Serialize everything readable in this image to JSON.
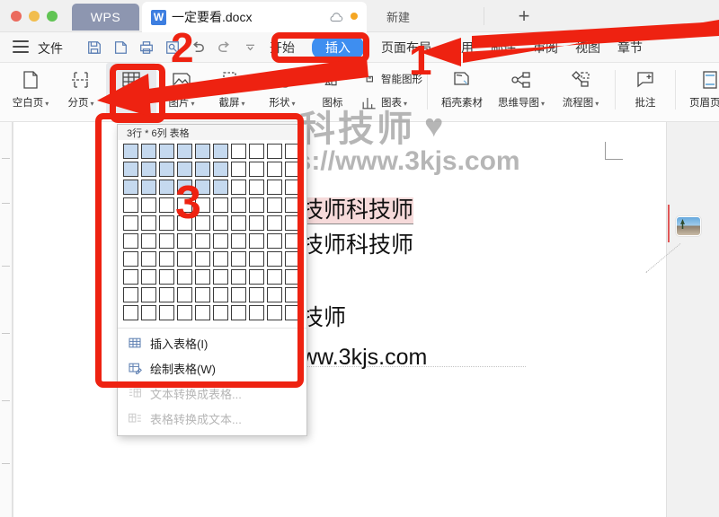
{
  "window": {
    "app_button": "WPS",
    "document_name": "一定要看.docx",
    "new_label": "新建",
    "traffic_lights": [
      "close-red",
      "minimize-yellow",
      "maximize-green"
    ],
    "plus_tab": "+",
    "cloud_icon": "cloud-icon",
    "status_dot": "sync-status-dot"
  },
  "ribbon": {
    "file_menu": "文件",
    "menu_icon": "hamburger-icon",
    "quick_access": [
      {
        "name": "save-icon"
      },
      {
        "name": "export-pdf-icon"
      },
      {
        "name": "print-icon"
      },
      {
        "name": "print-preview-icon"
      },
      {
        "name": "undo-icon"
      },
      {
        "name": "redo-icon"
      },
      {
        "name": "customize-chevron-icon"
      }
    ],
    "tabs": [
      {
        "label": "开始",
        "active": false
      },
      {
        "label": "插入",
        "active": true
      },
      {
        "label": "页面布局",
        "active": false
      },
      {
        "label": "引用",
        "active": false
      },
      {
        "label": "邮件",
        "active": false
      },
      {
        "label": "审阅",
        "active": false
      },
      {
        "label": "视图",
        "active": false
      },
      {
        "label": "章节",
        "active": false
      }
    ],
    "active_tab_color": "#3e8ef0"
  },
  "toolbar": {
    "items": [
      {
        "label": "空白页",
        "icon": "blank-page-icon",
        "caret": true,
        "selected": false
      },
      {
        "label": "分页",
        "icon": "page-break-icon",
        "caret": true,
        "selected": false
      },
      {
        "label": "表格",
        "icon": "table-icon",
        "caret": true,
        "selected": true
      },
      {
        "label": "图片",
        "icon": "picture-icon",
        "caret": true,
        "selected": false
      },
      {
        "label": "截屏",
        "icon": "screenshot-icon",
        "caret": true,
        "selected": false
      },
      {
        "label": "形状",
        "icon": "shapes-icon",
        "caret": true,
        "selected": false
      },
      {
        "label": "图标",
        "icon": "icons-icon",
        "caret": false,
        "selected": false
      }
    ],
    "stacked": [
      {
        "label": "智能图形",
        "icon": "smartart-icon",
        "caret": false
      },
      {
        "label": "图表",
        "icon": "chart-icon",
        "caret": true
      }
    ],
    "items2": [
      {
        "label": "稻壳素材",
        "icon": "docer-material-icon",
        "caret": false
      },
      {
        "label": "思维导图",
        "icon": "mindmap-icon",
        "caret": true
      },
      {
        "label": "流程图",
        "icon": "flowchart-icon",
        "caret": true
      },
      {
        "label": "批注",
        "icon": "comment-icon",
        "caret": false
      },
      {
        "label": "页眉页脚",
        "icon": "header-footer-icon",
        "caret": false
      },
      {
        "label": "页",
        "icon": "page-number-icon",
        "caret": false
      }
    ]
  },
  "table_dropdown": {
    "header": "3行 * 6列 表格",
    "grid": {
      "rows": 10,
      "cols": 10,
      "selected_rows": 3,
      "selected_cols": 6,
      "cell_on_color": "#c5d9ef",
      "cell_border_color": "#3a3a3a"
    },
    "menu": [
      {
        "label": "插入表格(I)",
        "icon": "insert-table-icon",
        "disabled": false
      },
      {
        "label": "绘制表格(W)",
        "icon": "draw-table-icon",
        "disabled": false
      },
      {
        "label": "文本转换成表格...",
        "icon": "text-to-table-icon",
        "disabled": true
      },
      {
        "label": "表格转换成文本...",
        "icon": "table-to-text-icon",
        "disabled": true
      }
    ]
  },
  "document": {
    "lines": [
      {
        "text": "技师科技师",
        "highlighted": true
      },
      {
        "text": "技师科技师",
        "highlighted": false
      },
      {
        "text": "技师",
        "highlighted": false
      },
      {
        "text": "ww.3kjs.com",
        "highlighted": false
      }
    ],
    "watermark_text": "科技师",
    "watermark_heart": "♥",
    "watermark_url": "https://www.3kjs.com",
    "highlight_color": "#f6dada"
  },
  "annotations": {
    "color": "#ee2211",
    "markers": [
      {
        "id": "1",
        "target": "插入"
      },
      {
        "id": "2",
        "target": "表格"
      },
      {
        "id": "3",
        "target": "grid"
      }
    ]
  }
}
